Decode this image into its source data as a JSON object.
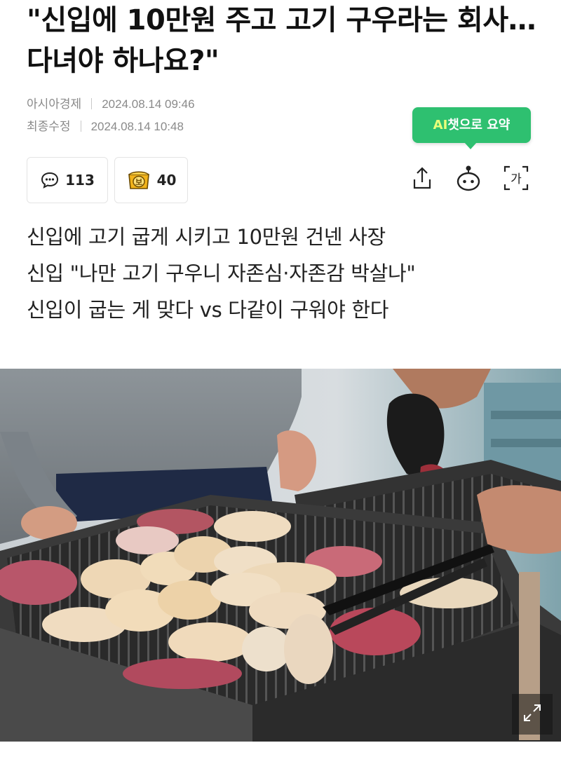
{
  "article": {
    "title": "\"신입에 10만원 주고 고기 구우라는 회사…다녀야 하나요?\"",
    "source": "아시아경제",
    "published": "2024.08.14 09:46",
    "modified_label": "최종수정",
    "modified": "2024.08.14 10:48"
  },
  "ai_summary": {
    "prefix": "AI",
    "label": "챗으로 요약"
  },
  "reactions": {
    "comments": {
      "icon": "comment-bubble-icon",
      "count": "113"
    },
    "reward": {
      "icon": "reward-coin-icon",
      "glyph": "보",
      "count": "40"
    }
  },
  "tools": {
    "share_icon": "share-icon",
    "bot_icon": "chatbot-icon",
    "font_icon": "font-size-icon",
    "font_glyph": "가"
  },
  "summary_lines": [
    "신입에 고기 굽게 시키고 10만원 건넨 사장",
    "신입 \"나만 고기 구우니 자존심·자존감 박살나\"",
    "신입이 굽는 게 맞다 vs 다같이 구워야 한다"
  ],
  "photo": {
    "expand_icon": "expand-icon"
  },
  "colors": {
    "ai_button": "#2ec070",
    "ai_accent": "#eaff7a",
    "reward": "#f2b31a"
  }
}
